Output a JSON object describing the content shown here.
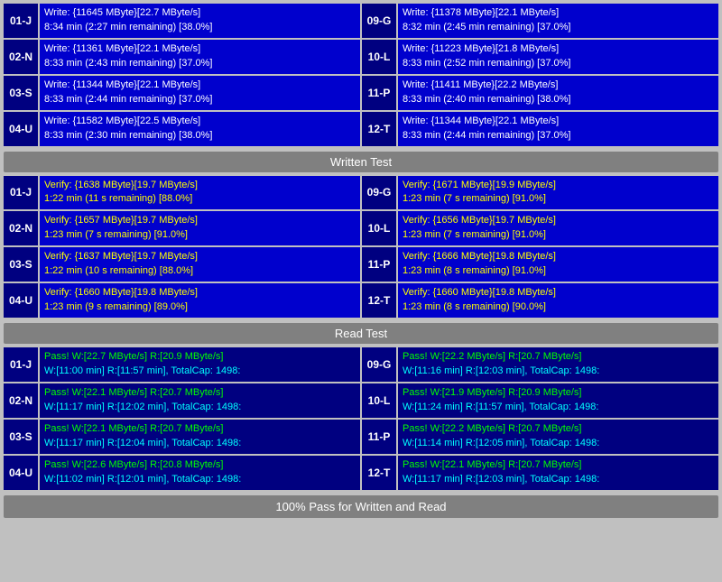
{
  "write_section": {
    "rows_left": [
      {
        "id": "01-J",
        "line1": "Write: {11645 MByte}[22.7 MByte/s]",
        "line2": "8:34 min (2:27 min remaining)  [38.0%]"
      },
      {
        "id": "02-N",
        "line1": "Write: {11361 MByte}[22.1 MByte/s]",
        "line2": "8:33 min (2:43 min remaining)  [37.0%]"
      },
      {
        "id": "03-S",
        "line1": "Write: {11344 MByte}[22.1 MByte/s]",
        "line2": "8:33 min (2:44 min remaining)  [37.0%]"
      },
      {
        "id": "04-U",
        "line1": "Write: {11582 MByte}[22.5 MByte/s]",
        "line2": "8:33 min (2:30 min remaining)  [38.0%]"
      }
    ],
    "rows_right": [
      {
        "id": "09-G",
        "line1": "Write: {11378 MByte}[22.1 MByte/s]",
        "line2": "8:32 min (2:45 min remaining)  [37.0%]"
      },
      {
        "id": "10-L",
        "line1": "Write: {11223 MByte}[21.8 MByte/s]",
        "line2": "8:33 min (2:52 min remaining)  [37.0%]"
      },
      {
        "id": "11-P",
        "line1": "Write: {11411 MByte}[22.2 MByte/s]",
        "line2": "8:33 min (2:40 min remaining)  [38.0%]"
      },
      {
        "id": "12-T",
        "line1": "Write: {11344 MByte}[22.1 MByte/s]",
        "line2": "8:33 min (2:44 min remaining)  [37.0%]"
      }
    ],
    "label": "Written Test"
  },
  "verify_section": {
    "rows_left": [
      {
        "id": "01-J",
        "line1": "Verify: {1638 MByte}[19.7 MByte/s]",
        "line2": "1:22 min (11 s remaining)   [88.0%]"
      },
      {
        "id": "02-N",
        "line1": "Verify: {1657 MByte}[19.7 MByte/s]",
        "line2": "1:23 min (7 s remaining)   [91.0%]"
      },
      {
        "id": "03-S",
        "line1": "Verify: {1637 MByte}[19.7 MByte/s]",
        "line2": "1:22 min (10 s remaining)   [88.0%]"
      },
      {
        "id": "04-U",
        "line1": "Verify: {1660 MByte}[19.8 MByte/s]",
        "line2": "1:23 min (9 s remaining)   [89.0%]"
      }
    ],
    "rows_right": [
      {
        "id": "09-G",
        "line1": "Verify: {1671 MByte}[19.9 MByte/s]",
        "line2": "1:23 min (7 s remaining)   [91.0%]"
      },
      {
        "id": "10-L",
        "line1": "Verify: {1656 MByte}[19.7 MByte/s]",
        "line2": "1:23 min (7 s remaining)   [91.0%]"
      },
      {
        "id": "11-P",
        "line1": "Verify: {1666 MByte}[19.8 MByte/s]",
        "line2": "1:23 min (8 s remaining)   [91.0%]"
      },
      {
        "id": "12-T",
        "line1": "Verify: {1660 MByte}[19.8 MByte/s]",
        "line2": "1:23 min (8 s remaining)   [90.0%]"
      }
    ],
    "label": "Read Test"
  },
  "pass_section": {
    "rows_left": [
      {
        "id": "01-J",
        "line1": "Pass! W:[22.7 MByte/s] R:[20.9 MByte/s]",
        "line2": "W:[11:00 min] R:[11:57 min], TotalCap: 1498:"
      },
      {
        "id": "02-N",
        "line1": "Pass! W:[22.1 MByte/s] R:[20.7 MByte/s]",
        "line2": "W:[11:17 min] R:[12:02 min], TotalCap: 1498:"
      },
      {
        "id": "03-S",
        "line1": "Pass! W:[22.1 MByte/s] R:[20.7 MByte/s]",
        "line2": "W:[11:17 min] R:[12:04 min], TotalCap: 1498:"
      },
      {
        "id": "04-U",
        "line1": "Pass! W:[22.6 MByte/s] R:[20.8 MByte/s]",
        "line2": "W:[11:02 min] R:[12:01 min], TotalCap: 1498:"
      }
    ],
    "rows_right": [
      {
        "id": "09-G",
        "line1": "Pass! W:[22.2 MByte/s] R:[20.7 MByte/s]",
        "line2": "W:[11:16 min] R:[12:03 min], TotalCap: 1498:"
      },
      {
        "id": "10-L",
        "line1": "Pass! W:[21.9 MByte/s] R:[20.9 MByte/s]",
        "line2": "W:[11:24 min] R:[11:57 min], TotalCap: 1498:"
      },
      {
        "id": "11-P",
        "line1": "Pass! W:[22.2 MByte/s] R:[20.7 MByte/s]",
        "line2": "W:[11:14 min] R:[12:05 min], TotalCap: 1498:"
      },
      {
        "id": "12-T",
        "line1": "Pass! W:[22.1 MByte/s] R:[20.7 MByte/s]",
        "line2": "W:[11:17 min] R:[12:03 min], TotalCap: 1498:"
      }
    ]
  },
  "bottom_status": "100% Pass for Written and Read"
}
